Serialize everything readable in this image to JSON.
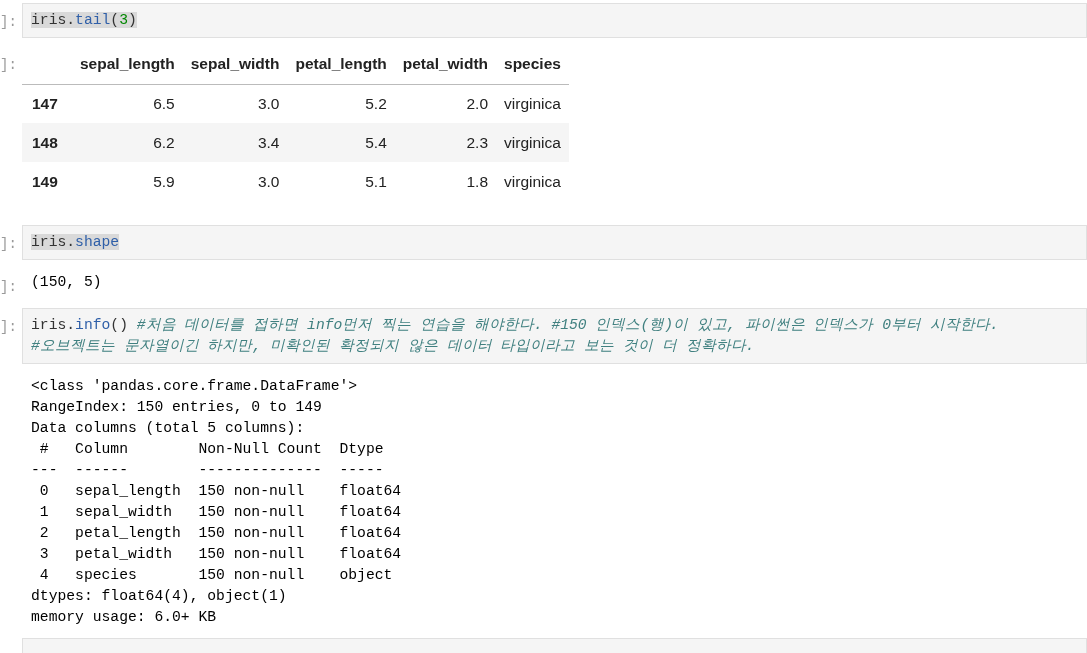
{
  "cells": [
    {
      "kind": "input",
      "prompt": "]:",
      "lines": [
        {
          "highlighted": true,
          "tokens": [
            {
              "kind": "name",
              "text": "iris"
            },
            {
              "kind": "punct",
              "text": "."
            },
            {
              "kind": "attr",
              "text": "tail"
            },
            {
              "kind": "punct",
              "text": "("
            },
            {
              "kind": "number",
              "text": "3"
            },
            {
              "kind": "punct",
              "text": ")"
            }
          ]
        }
      ]
    },
    {
      "kind": "table_output",
      "prompt": "]:",
      "columns": [
        "sepal_length",
        "sepal_width",
        "petal_length",
        "petal_width",
        "species"
      ],
      "rows": [
        {
          "index": "147",
          "cells": [
            "6.5",
            "3.0",
            "5.2",
            "2.0",
            "virginica"
          ]
        },
        {
          "index": "148",
          "cells": [
            "6.2",
            "3.4",
            "5.4",
            "2.3",
            "virginica"
          ]
        },
        {
          "index": "149",
          "cells": [
            "5.9",
            "3.0",
            "5.1",
            "1.8",
            "virginica"
          ]
        }
      ]
    },
    {
      "kind": "input",
      "prompt": "]:",
      "lines": [
        {
          "highlighted": true,
          "tokens": [
            {
              "kind": "name",
              "text": "iris"
            },
            {
              "kind": "punct",
              "text": "."
            },
            {
              "kind": "attr",
              "text": "shape"
            }
          ]
        }
      ]
    },
    {
      "kind": "text_output",
      "prompt": "]:",
      "lines": [
        "(150, 5)"
      ]
    },
    {
      "kind": "input",
      "prompt": "]:",
      "lines": [
        {
          "highlighted": false,
          "tokens": [
            {
              "kind": "name",
              "text": "iris"
            },
            {
              "kind": "punct",
              "text": "."
            },
            {
              "kind": "attr",
              "text": "info"
            },
            {
              "kind": "punct",
              "text": "() "
            },
            {
              "kind": "comment",
              "text": "#처음 데이터를 접하면 info먼저 찍는 연습을 해야한다. #150 인덱스(행)이 있고, 파이썬은 인덱스가 0부터 시작한다."
            }
          ]
        },
        {
          "highlighted": false,
          "tokens": [
            {
              "kind": "comment",
              "text": "#오브젝트는 문자열이긴 하지만, 미확인된 확정되지 않은 데이터 타입이라고 보는 것이 더 정확하다."
            }
          ]
        }
      ]
    },
    {
      "kind": "text_output",
      "lines": [
        "<class 'pandas.core.frame.DataFrame'>",
        "RangeIndex: 150 entries, 0 to 149",
        "Data columns (total 5 columns):",
        " #   Column        Non-Null Count  Dtype  ",
        "---  ------        --------------  -----  ",
        " 0   sepal_length  150 non-null    float64",
        " 1   sepal_width   150 non-null    float64",
        " 2   petal_length  150 non-null    float64",
        " 3   petal_width   150 non-null    float64",
        " 4   species       150 non-null    object ",
        "dtypes: float64(4), object(1)",
        "memory usage: 6.0+ KB"
      ]
    },
    {
      "kind": "input_stub"
    }
  ]
}
